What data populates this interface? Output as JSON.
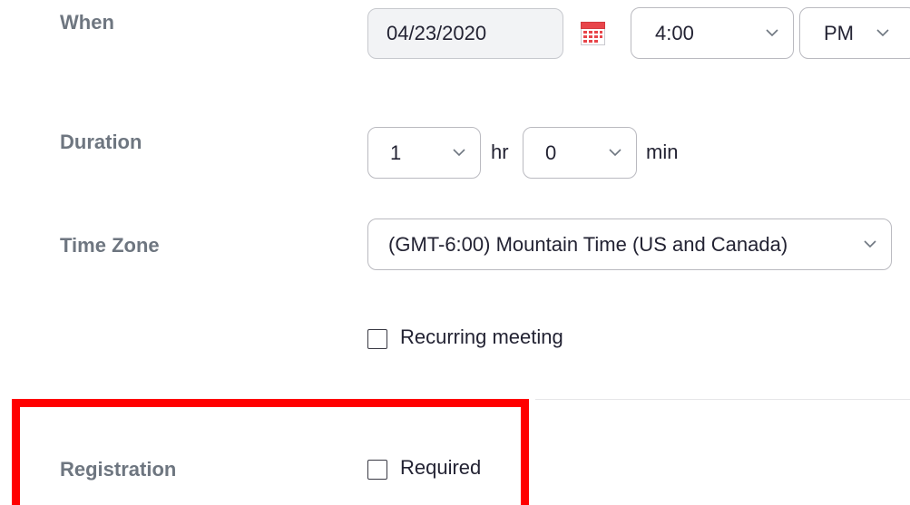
{
  "when": {
    "label": "When",
    "date_value": "04/23/2020",
    "time_value": "4:00",
    "ampm_value": "PM"
  },
  "duration": {
    "label": "Duration",
    "hours_value": "1",
    "hours_unit": "hr",
    "minutes_value": "0",
    "minutes_unit": "min"
  },
  "timezone": {
    "label": "Time Zone",
    "value": "(GMT-6:00) Mountain Time (US and Canada)"
  },
  "recurring": {
    "label": "Recurring meeting",
    "checked": false
  },
  "registration": {
    "label": "Registration",
    "checkbox_label": "Required",
    "checked": false
  },
  "colors": {
    "label_gray": "#6e7680",
    "highlight_red": "#ff0000",
    "border": "#babac0",
    "calendar_red": "#e8454a"
  }
}
